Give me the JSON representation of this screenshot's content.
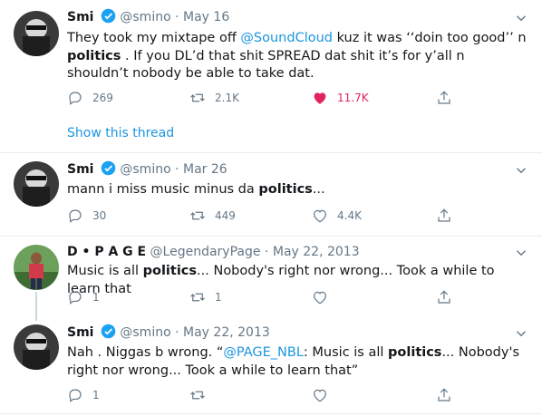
{
  "thread": {
    "show_label": "Show this thread"
  },
  "tweets": [
    {
      "name": "Smi",
      "handle": "@smino",
      "separator": "·",
      "date": "May 16",
      "verified": true,
      "text": [
        {
          "t": "They took my mixtape off "
        },
        {
          "t": "@SoundCloud",
          "link": true
        },
        {
          "t": " kuz it was ‘‘doin too good’’ n "
        },
        {
          "t": "politics",
          "bold": true
        },
        {
          "t": " . If you DL’d that shit SPREAD dat shit it’s for y’all n shouldn’t nobody be able to take dat."
        }
      ],
      "replies": "269",
      "retweets": "2.1K",
      "likes": "11.7K",
      "liked": true
    },
    {
      "name": "Smi",
      "handle": "@smino",
      "separator": "·",
      "date": "Mar 26",
      "verified": true,
      "text": [
        {
          "t": "mann i miss music minus da "
        },
        {
          "t": "politics",
          "bold": true
        },
        {
          "t": "..."
        }
      ],
      "replies": "30",
      "retweets": "449",
      "likes": "4.4K",
      "liked": false
    },
    {
      "name": "D • P A G E",
      "handle": "@LegendaryPage",
      "separator": "·",
      "date": "May 22, 2013",
      "verified": false,
      "text": [
        {
          "t": "Music is all "
        },
        {
          "t": "politics",
          "bold": true
        },
        {
          "t": "... Nobody's right nor wrong... Took a while to learn that"
        }
      ],
      "replies": "1",
      "retweets": "1",
      "likes": "",
      "liked": false
    },
    {
      "name": "Smi",
      "handle": "@smino",
      "separator": "·",
      "date": "May 22, 2013",
      "verified": true,
      "text": [
        {
          "t": "Nah . Niggas b wrong. “"
        },
        {
          "t": "@PAGE_NBL",
          "link": true
        },
        {
          "t": ": Music is all "
        },
        {
          "t": "politics",
          "bold": true
        },
        {
          "t": "... Nobody's right nor wrong... Took a while to learn that”"
        }
      ],
      "replies": "1",
      "retweets": "",
      "likes": "",
      "liked": false
    }
  ],
  "colors": {
    "accent": "#1b95e0",
    "like": "#e0245e",
    "muted": "#657786",
    "divider": "#e6ecf0",
    "verified": "#1da1f2"
  },
  "icons": {
    "reply": "reply-icon",
    "retweet": "retweet-icon",
    "like": "heart-icon",
    "share": "share-icon",
    "caret": "chevron-down-icon",
    "verified": "verified-badge-icon"
  }
}
